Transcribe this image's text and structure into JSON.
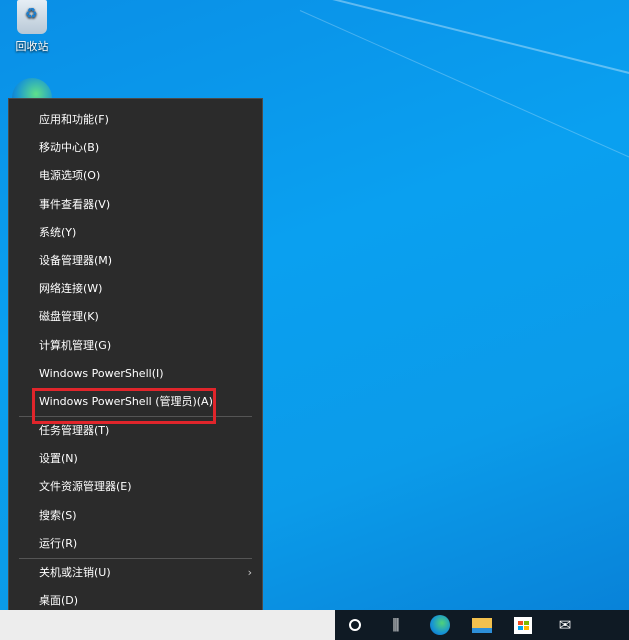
{
  "desktop": {
    "recycle_bin_label": "回收站"
  },
  "menu": {
    "items": [
      {
        "label": "应用和功能(F)"
      },
      {
        "label": "移动中心(B)"
      },
      {
        "label": "电源选项(O)"
      },
      {
        "label": "事件查看器(V)"
      },
      {
        "label": "系统(Y)"
      },
      {
        "label": "设备管理器(M)"
      },
      {
        "label": "网络连接(W)"
      },
      {
        "label": "磁盘管理(K)"
      },
      {
        "label": "计算机管理(G)"
      },
      {
        "label": "Windows PowerShell(I)"
      },
      {
        "label": "Windows PowerShell (管理员)(A)"
      },
      {
        "label": "任务管理器(T)"
      },
      {
        "label": "设置(N)"
      },
      {
        "label": "文件资源管理器(E)"
      },
      {
        "label": "搜索(S)"
      },
      {
        "label": "运行(R)"
      },
      {
        "label": "关机或注销(U)"
      },
      {
        "label": "桌面(D)"
      }
    ],
    "highlight_color": "#e0252b"
  },
  "taskbar": {
    "icons": [
      "cortana-icon",
      "task-view-icon",
      "edge-icon",
      "file-explorer-icon",
      "store-icon",
      "mail-icon"
    ]
  }
}
